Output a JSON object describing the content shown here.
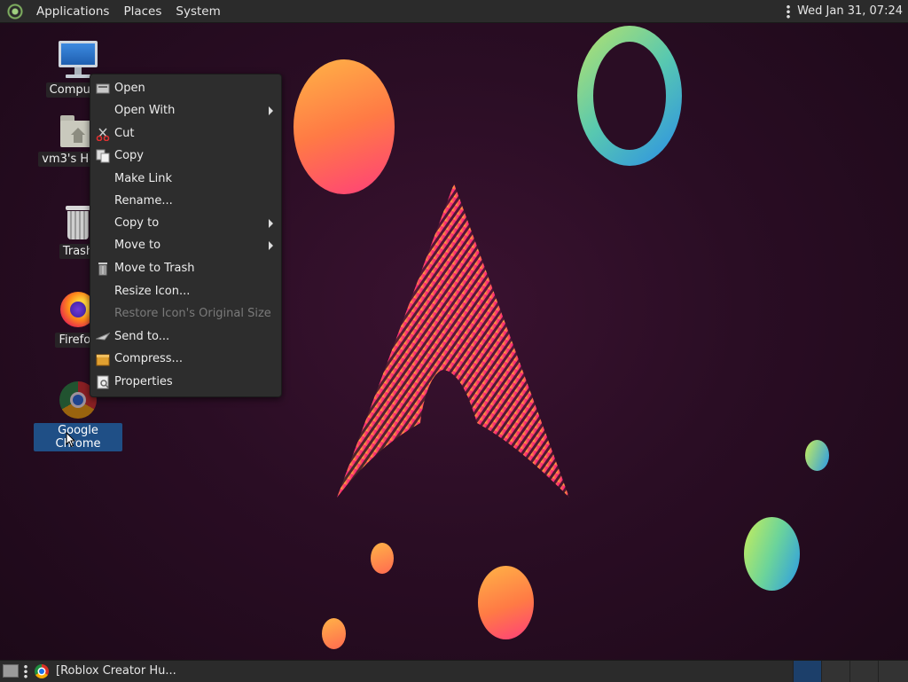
{
  "top_panel": {
    "menus": [
      "Applications",
      "Places",
      "System"
    ],
    "clock": "Wed Jan 31, 07:24"
  },
  "desktop_icons": [
    {
      "label": "Computer",
      "icon": "computer-icon"
    },
    {
      "label": "vm3's Home",
      "icon": "home-folder-icon"
    },
    {
      "label": "Trash",
      "icon": "trash-icon"
    },
    {
      "label": "Firefox",
      "icon": "firefox-icon"
    },
    {
      "label": "Google Chrome",
      "icon": "chrome-icon",
      "selected": true
    }
  ],
  "context_menu": {
    "items": [
      {
        "label": "Open",
        "icon": "open-icon",
        "submenu": false,
        "disabled": false
      },
      {
        "label": "Open With",
        "icon": "",
        "submenu": true,
        "disabled": false
      },
      {
        "label": "Cut",
        "icon": "scissors-icon",
        "submenu": false,
        "disabled": false
      },
      {
        "label": "Copy",
        "icon": "copy-icon",
        "submenu": false,
        "disabled": false
      },
      {
        "label": "Make Link",
        "icon": "",
        "submenu": false,
        "disabled": false
      },
      {
        "label": "Rename...",
        "icon": "",
        "submenu": false,
        "disabled": false
      },
      {
        "label": "Copy to",
        "icon": "",
        "submenu": true,
        "disabled": false
      },
      {
        "label": "Move to",
        "icon": "",
        "submenu": true,
        "disabled": false
      },
      {
        "label": "Move to Trash",
        "icon": "trash-icon",
        "submenu": false,
        "disabled": false
      },
      {
        "label": "Resize Icon...",
        "icon": "",
        "submenu": false,
        "disabled": false
      },
      {
        "label": "Restore Icon's Original Size",
        "icon": "",
        "submenu": false,
        "disabled": true
      },
      {
        "label": "Send to...",
        "icon": "send-icon",
        "submenu": false,
        "disabled": false
      },
      {
        "label": "Compress...",
        "icon": "archive-icon",
        "submenu": false,
        "disabled": false
      },
      {
        "label": "Properties",
        "icon": "properties-icon",
        "submenu": false,
        "disabled": false
      }
    ]
  },
  "bottom_panel": {
    "task_label": "[Roblox Creator Hu..."
  },
  "colors": {
    "panel_bg": "#2b2b2b",
    "menu_bg": "#2d2d2d",
    "selection": "#1f4f86"
  }
}
